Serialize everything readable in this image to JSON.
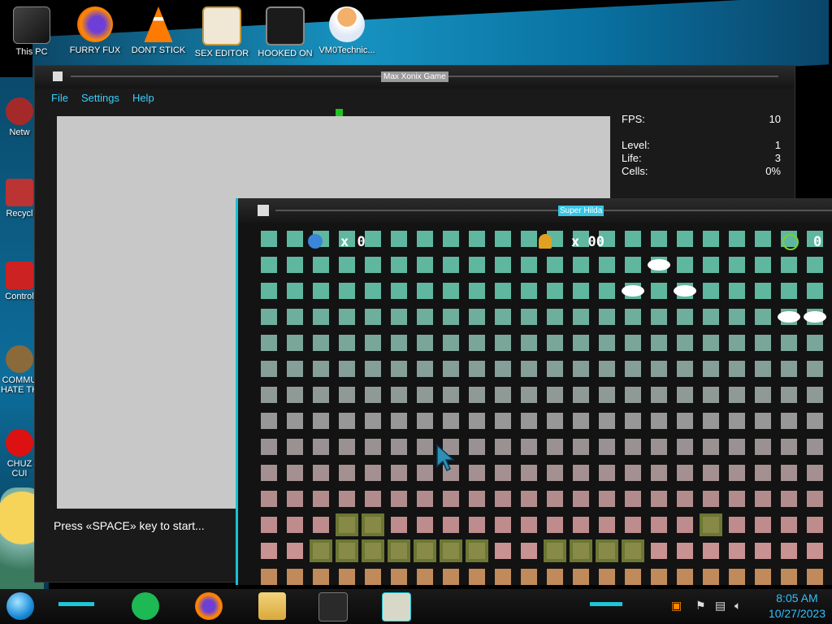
{
  "desktop": {
    "icons": [
      {
        "label": "This PC"
      },
      {
        "label": "FURRY FUX"
      },
      {
        "label": "DONT STICK THIS IN YO..."
      },
      {
        "label": "SEX EDITOR"
      },
      {
        "label": "HOOKED ON XONIX"
      },
      {
        "label": "VM0Technic..."
      }
    ],
    "left_icons": [
      {
        "label": "Netw"
      },
      {
        "label": "Recycl"
      },
      {
        "label": "Control"
      },
      {
        "label": "COMMU HATE TH"
      },
      {
        "label": "CHUZ CUI"
      }
    ]
  },
  "xonix_window": {
    "title": "Max Xonix Game",
    "menu": [
      "File",
      "Settings",
      "Help"
    ],
    "stats": [
      {
        "label": "FPS:",
        "value": "10"
      },
      {
        "label": "Level:",
        "value": "1"
      },
      {
        "label": "Life:",
        "value": "3"
      },
      {
        "label": "Cells:",
        "value": "0%"
      }
    ],
    "prompt": "Press «SPACE» key to start..."
  },
  "hilda_window": {
    "title": "Super Hilda",
    "hud": {
      "lives": "x 0",
      "bells": "x 00",
      "timer": "0"
    }
  },
  "taskbar": {
    "time": "8:05 AM",
    "date": "10/27/2023"
  },
  "colors": {
    "accent": "#1cc7d8",
    "xonix_field": "#c8c8c8",
    "tile_teal": "#5fb7a0",
    "tile_pink": "#c89292"
  }
}
